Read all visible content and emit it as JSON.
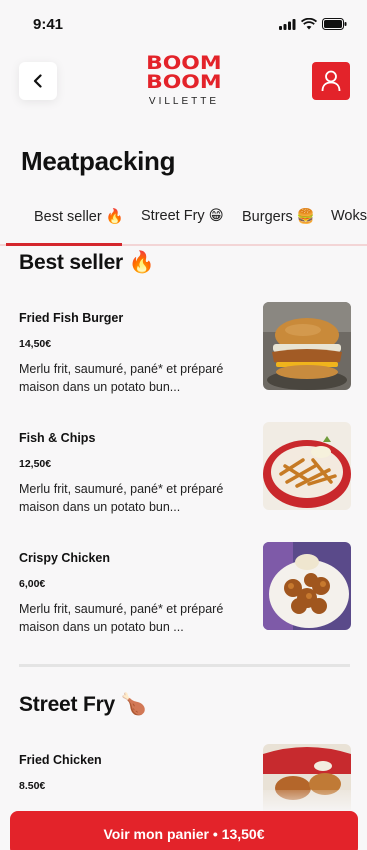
{
  "status_bar": {
    "time": "9:41"
  },
  "header": {
    "logo_line1": "BOOM",
    "logo_line2": "BOOM",
    "logo_sub": "VILLETTE"
  },
  "page": {
    "title": "Meatpacking"
  },
  "tabs": [
    {
      "label": "Best seller 🔥"
    },
    {
      "label": "Street Fry 😁"
    },
    {
      "label": "Burgers 🍔"
    },
    {
      "label": "Woks"
    }
  ],
  "sections": {
    "best_seller": {
      "title": "Best seller 🔥",
      "items": [
        {
          "name": "Fried Fish Burger",
          "price": "14,50€",
          "description": "Merlu frit, saumuré, pané* et préparé maison dans un potato bun..."
        },
        {
          "name": "Fish & Chips",
          "price": "12,50€",
          "description": "Merlu frit, saumuré, pané* et préparé maison dans un potato bun..."
        },
        {
          "name": "Crispy Chicken",
          "price": "6,00€",
          "description": "Merlu frit, saumuré, pané* et préparé maison dans un potato bun ..."
        }
      ]
    },
    "street_fry": {
      "title": "Street Fry 🍗",
      "items": [
        {
          "name": "Fried Chicken",
          "price": "8.50€"
        }
      ]
    }
  },
  "cart": {
    "label": "Voir mon panier • 13,50€"
  },
  "colors": {
    "accent": "#e3232a",
    "tab_active": "#d4262c",
    "background": "#f8f7f8"
  }
}
